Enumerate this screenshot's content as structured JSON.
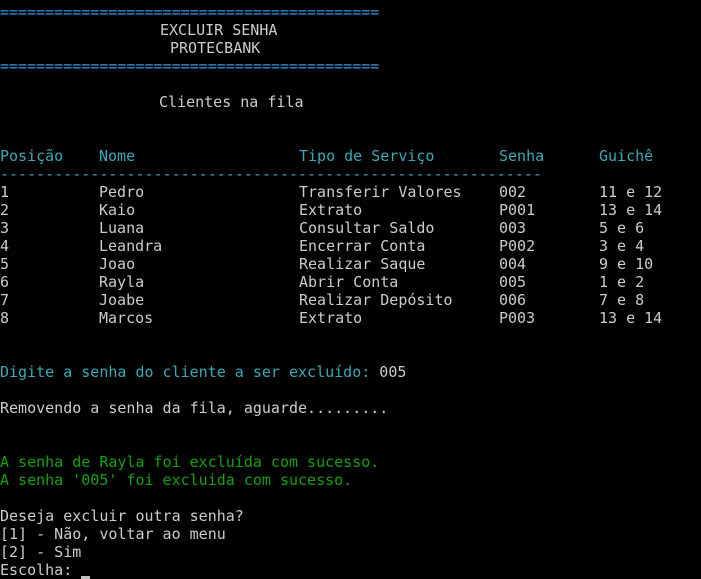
{
  "header": {
    "rule": "==========================================",
    "title": "EXCLUIR SENHA",
    "subtitle": "PROTECBANK"
  },
  "queue": {
    "heading": "Clientes na fila",
    "columns": [
      "Posição",
      "Nome",
      "Tipo de Serviço",
      "Senha",
      "Guichê"
    ],
    "separator": "------------------------------------------------------------",
    "rows": [
      {
        "pos": "1",
        "nome": "Pedro",
        "servico": "Transferir Valores",
        "senha": "002",
        "guiche": "11 e 12"
      },
      {
        "pos": "2",
        "nome": "Kaio",
        "servico": "Extrato",
        "senha": "P001",
        "guiche": "13 e 14"
      },
      {
        "pos": "3",
        "nome": "Luana",
        "servico": "Consultar Saldo",
        "senha": "003",
        "guiche": "5 e 6"
      },
      {
        "pos": "4",
        "nome": "Leandra",
        "servico": "Encerrar Conta",
        "senha": "P002",
        "guiche": "3 e 4"
      },
      {
        "pos": "5",
        "nome": "Joao",
        "servico": "Realizar Saque",
        "senha": "004",
        "guiche": "9 e 10"
      },
      {
        "pos": "6",
        "nome": "Rayla",
        "servico": "Abrir Conta",
        "senha": "005",
        "guiche": "1 e 2"
      },
      {
        "pos": "7",
        "nome": "Joabe",
        "servico": "Realizar Depósito",
        "senha": "006",
        "guiche": "7 e 8"
      },
      {
        "pos": "8",
        "nome": "Marcos",
        "servico": "Extrato",
        "senha": "P003",
        "guiche": "13 e 14"
      }
    ]
  },
  "prompt": {
    "label": "Digite a senha do cliente a ser excluído: ",
    "value": "005"
  },
  "progress": "Removendo a senha da fila, aguarde.........",
  "success": {
    "line1": "A senha de Rayla foi excluída com sucesso.",
    "line2": "A senha '005' foi excluida com sucesso."
  },
  "menu": {
    "question": "Deseja excluir outra senha?",
    "option1": "[1] - Não, voltar ao menu",
    "option2": "[2] - Sim",
    "choice_label": "Escolha: "
  },
  "colors": {
    "background": "#000000",
    "text": "#c0c0c0",
    "header_blue": "#3a96dd",
    "table_cyan": "#3aa8b8",
    "success_green": "#13a10e"
  }
}
